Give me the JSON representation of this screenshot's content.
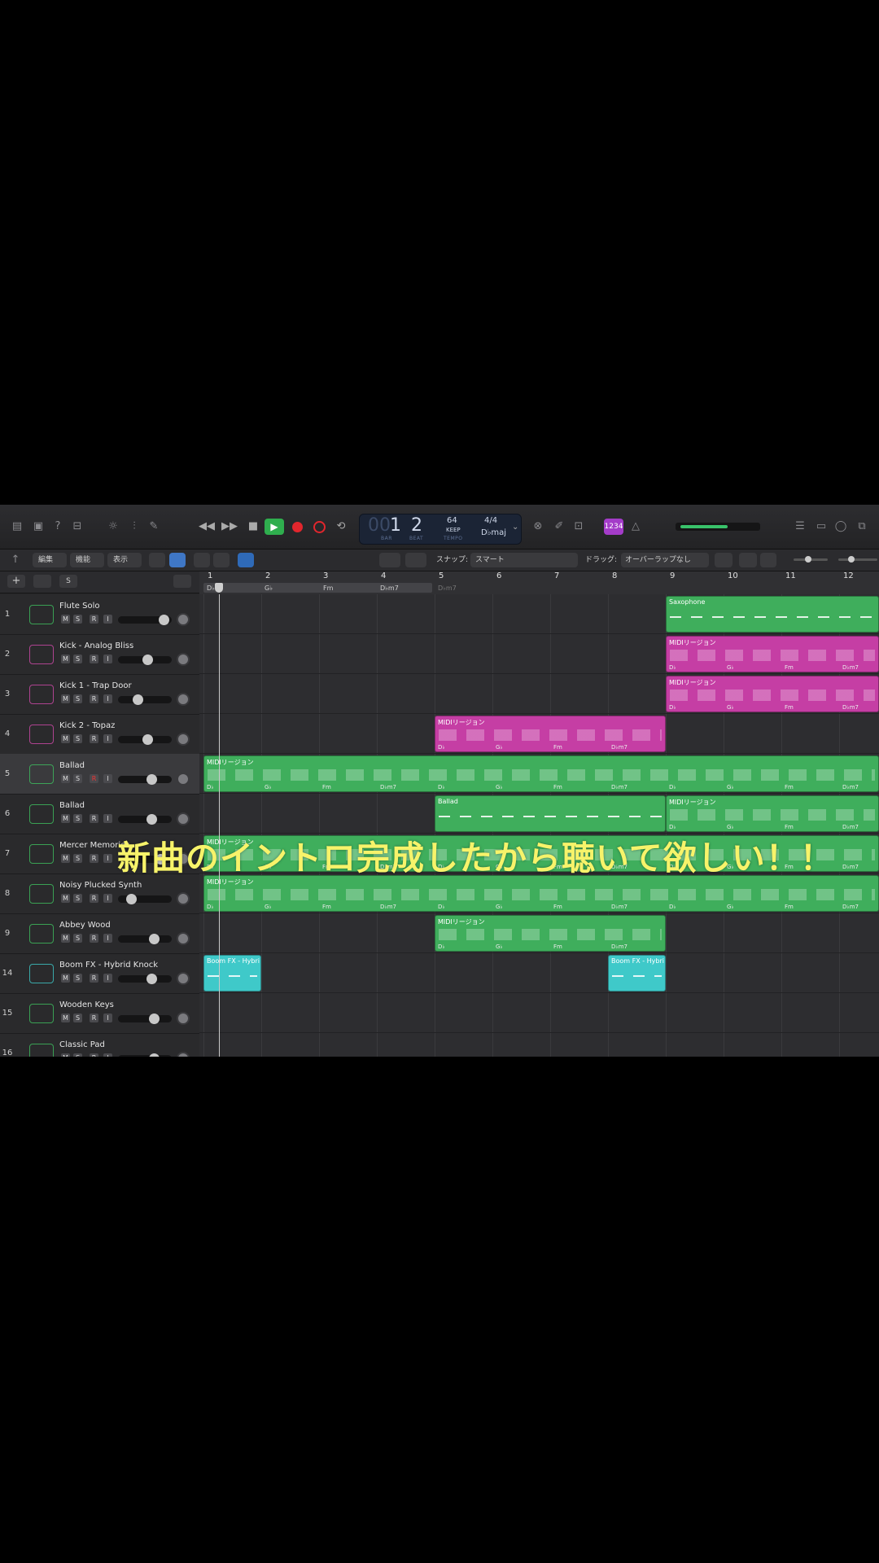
{
  "transport": {
    "bar": "1",
    "beat": "2",
    "bar_label": "BAR",
    "beat_label": "BEAT",
    "tempo": "64",
    "tempo_mode": "KEEP",
    "tempo_label": "TEMPO",
    "signature": "4/4",
    "key": "D♭maj",
    "count_in": "1234"
  },
  "toolbar": {
    "edit": "編集",
    "function": "機能",
    "view": "表示",
    "snap_label": "スナップ:",
    "snap_value": "スマート",
    "drag_label": "ドラッグ:",
    "drag_value": "オーバーラップなし"
  },
  "ruler": {
    "bars": [
      "1",
      "2",
      "3",
      "4",
      "5",
      "6",
      "7",
      "8",
      "9",
      "10",
      "11",
      "12"
    ],
    "chords": [
      "D♭",
      "G♭",
      "Fm",
      "D♭m7",
      "D♭m7"
    ]
  },
  "tracks": [
    {
      "num": "1",
      "name": "Flute Solo"
    },
    {
      "num": "2",
      "name": "Kick - Analog Bliss"
    },
    {
      "num": "3",
      "name": "Kick 1 - Trap Door"
    },
    {
      "num": "4",
      "name": "Kick 2 - Topaz"
    },
    {
      "num": "5",
      "name": "Ballad"
    },
    {
      "num": "6",
      "name": "Ballad"
    },
    {
      "num": "7",
      "name": "Mercer Memories"
    },
    {
      "num": "8",
      "name": "Noisy Plucked Synth"
    },
    {
      "num": "9",
      "name": "Abbey Wood"
    },
    {
      "num": "14",
      "name": "Boom FX - Hybrid Knock"
    },
    {
      "num": "15",
      "name": "Wooden Keys"
    },
    {
      "num": "16",
      "name": "Classic Pad"
    }
  ],
  "msri": [
    "M",
    "S",
    "R",
    "I"
  ],
  "regions": {
    "saxophone": "Saxophone",
    "midi": "MIDIリージョン",
    "ballad": "Ballad",
    "boom": "Boom FX - Hybri"
  },
  "region_chords": [
    "D♭",
    "G♭",
    "Fm",
    "D♭m7"
  ],
  "caption": "新曲のイントロ完成したから聴いて欲しい！！",
  "colors": {
    "green": "#3fae5c",
    "pink": "#c53ea4",
    "cyan": "#3fc9c9",
    "caption": "#f7f36a"
  }
}
